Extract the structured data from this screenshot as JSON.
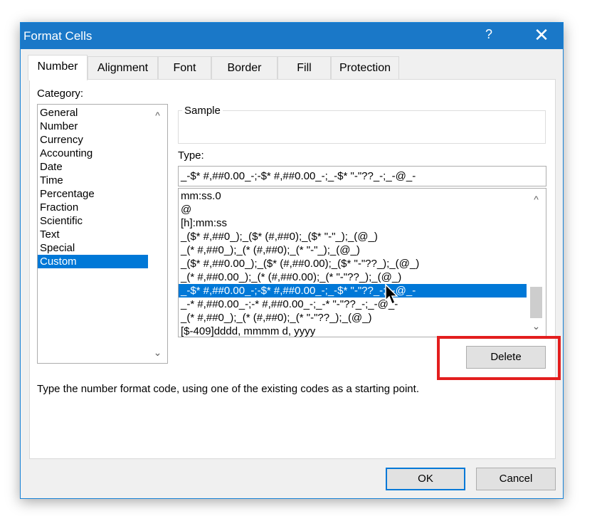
{
  "window": {
    "title": "Format Cells",
    "help_label": "?",
    "close_label": "✕"
  },
  "tabs": [
    {
      "label": "Number",
      "active": true
    },
    {
      "label": "Alignment"
    },
    {
      "label": "Font"
    },
    {
      "label": "Border"
    },
    {
      "label": "Fill"
    },
    {
      "label": "Protection"
    }
  ],
  "category": {
    "label": "Category:",
    "items": [
      "General",
      "Number",
      "Currency",
      "Accounting",
      "Date",
      "Time",
      "Percentage",
      "Fraction",
      "Scientific",
      "Text",
      "Special",
      "Custom"
    ],
    "selected": "Custom"
  },
  "sample": {
    "label": "Sample"
  },
  "type": {
    "label": "Type:",
    "value": "_-$* #,##0.00_-;-$* #,##0.00_-;_-$* \"-\"??_-;_-@_-",
    "items": [
      "mm:ss.0",
      "@",
      "[h]:mm:ss",
      "_($* #,##0_);_($* (#,##0);_($* \"-\"_);_(@_)",
      "_(* #,##0_);_(* (#,##0);_(* \"-\"_);_(@_)",
      "_($* #,##0.00_);_($* (#,##0.00);_($* \"-\"??_);_(@_)",
      "_(* #,##0.00_);_(* (#,##0.00);_(* \"-\"??_);_(@_)",
      "_-$* #,##0.00_-;-$* #,##0.00_-;_-$* \"-\"??_-;_-@_-",
      "_-* #,##0.00_-;-* #,##0.00_-;_-* \"-\"??_-;_-@_-",
      "_(* #,##0_);_(* (#,##0);_(* \"-\"??_);_(@_)",
      "[$-409]dddd, mmmm d, yyyy"
    ],
    "selected_index": 7
  },
  "delete_label": "Delete",
  "description": "Type the number format code, using one of the existing codes as a starting point.",
  "ok_label": "OK",
  "cancel_label": "Cancel",
  "icons": {
    "scroll_up": "^",
    "scroll_down": "⌄"
  },
  "colors": {
    "titlebar": "#1a78c8",
    "selection": "#0078d7",
    "highlight": "#e31e1e"
  }
}
